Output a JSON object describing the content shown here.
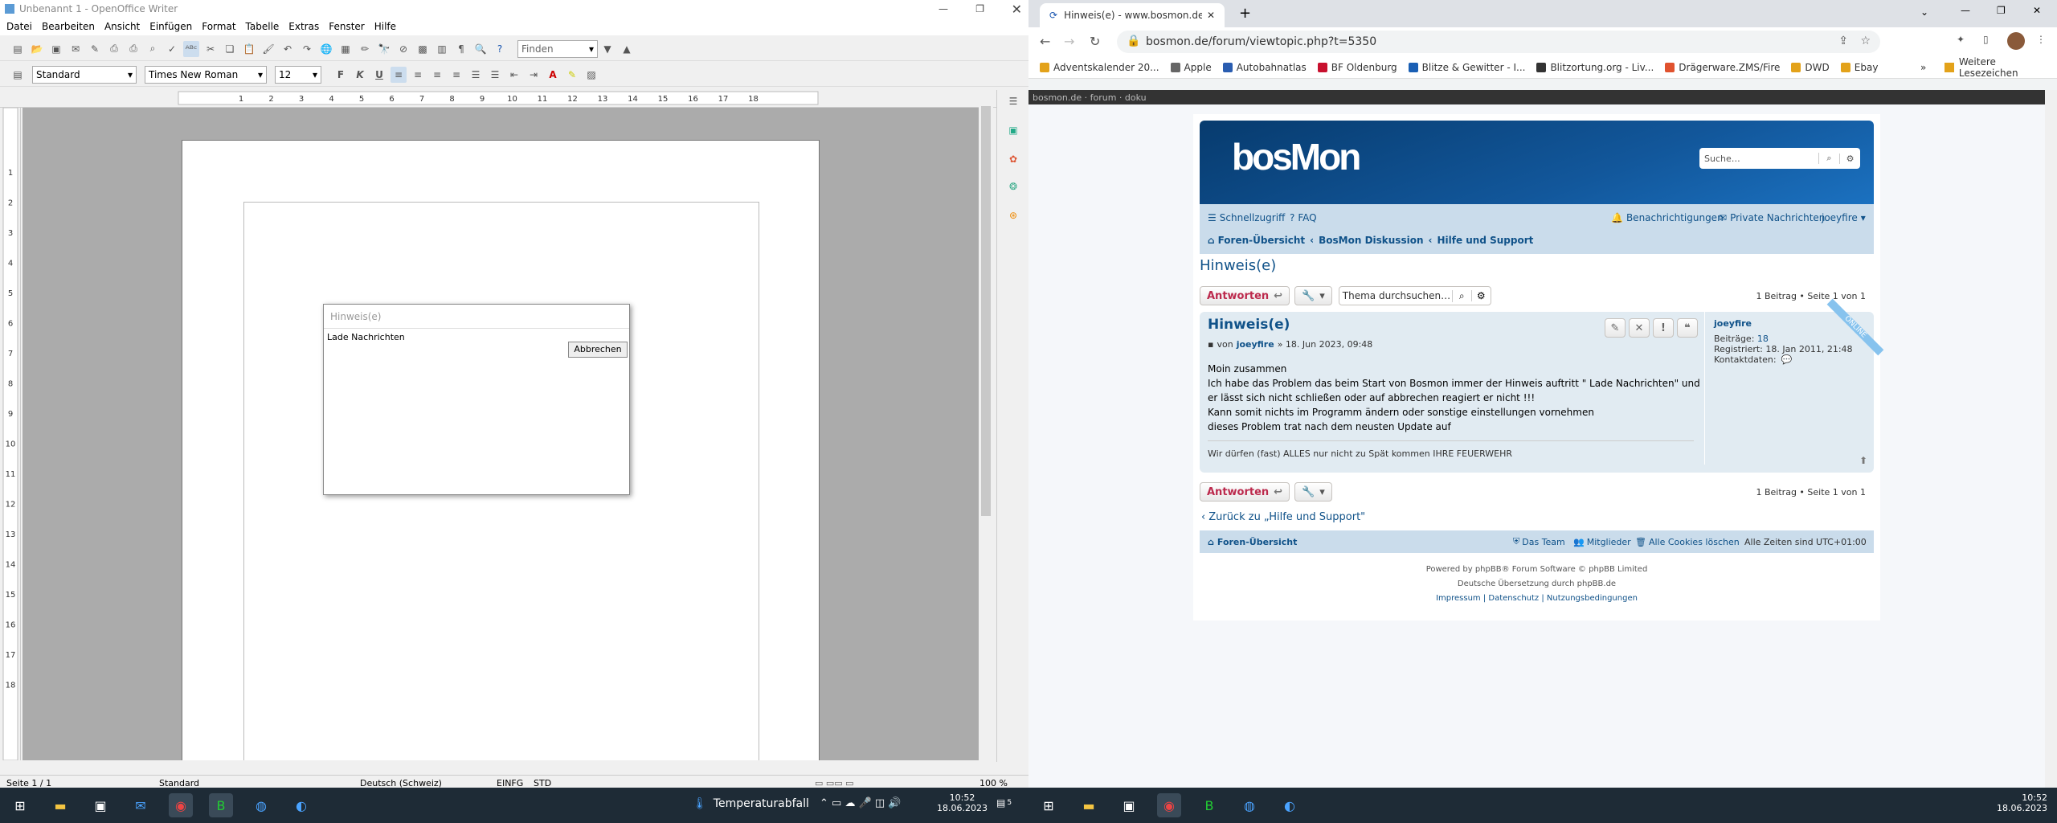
{
  "writer": {
    "title": "Unbenannt 1 - OpenOffice Writer",
    "menu": [
      "Datei",
      "Bearbeiten",
      "Ansicht",
      "Einfügen",
      "Format",
      "Tabelle",
      "Extras",
      "Fenster",
      "Hilfe"
    ],
    "find_placeholder": "Finden",
    "style": "Standard",
    "font": "Times New Roman",
    "size": "12",
    "ruler_marks": [
      "1",
      "2",
      "3",
      "4",
      "5",
      "6",
      "7",
      "8",
      "9",
      "10",
      "11",
      "12",
      "13",
      "14",
      "15",
      "16",
      "17",
      "18"
    ],
    "status": {
      "page": "Seite 1 / 1",
      "style": "Standard",
      "lang": "Deutsch (Schweiz)",
      "insert": "EINFG",
      "sel": "STD",
      "zoom": "100 %"
    },
    "dialog": {
      "title": "Hinweis(e)",
      "message": "Lade Nachrichten",
      "cancel": "Abbrechen"
    }
  },
  "chrome": {
    "tab_title": "Hinweis(e) - www.bosmon.de/fo",
    "url": "bosmon.de/forum/viewtopic.php?t=5350",
    "bookmarks": [
      {
        "label": "Adventskalender 20...",
        "color": "#e3a21a"
      },
      {
        "label": "Apple",
        "color": "#666666"
      },
      {
        "label": "Autobahnatlas",
        "color": "#2a5db0"
      },
      {
        "label": "BF Oldenburg",
        "color": "#c8102e"
      },
      {
        "label": "Blitze & Gewitter - I...",
        "color": "#1a5fb4"
      },
      {
        "label": "Blitzortung.org - Liv...",
        "color": "#333333"
      },
      {
        "label": "Drägerware.ZMS/Fire",
        "color": "#e0522e"
      },
      {
        "label": "DWD",
        "color": "#e3a21a"
      },
      {
        "label": "Ebay",
        "color": "#e3a21a"
      }
    ],
    "more_bookmarks": "Weitere Lesezeichen"
  },
  "forum": {
    "topbar": "bosmon.de · forum · doku",
    "logo": "bosMon",
    "search_placeholder": "Suche…",
    "quicklinks": "Schnellzugriff",
    "faq": "FAQ",
    "notifications": "Benachrichtigungen",
    "pm": "Private Nachrichten",
    "user": "joeyfire",
    "breadcrumb": [
      "Foren-Übersicht",
      "BosMon Diskussion",
      "Hilfe und Support"
    ],
    "topic_title": "Hinweis(e)",
    "reply": "Antworten",
    "topic_search_placeholder": "Thema durchsuchen…",
    "pagination": "1 Beitrag • Seite 1 von 1",
    "post": {
      "title": "Hinweis(e)",
      "meta_by": "von",
      "author": "joeyfire",
      "date": "» 18. Jun 2023, 09:48",
      "lines": [
        "Moin zusammen",
        "Ich habe das Problem das beim Start von Bosmon immer der Hinweis auftritt \" Lade Nachrichten\" und",
        "er lässt sich nicht schließen oder auf abbrechen reagiert er nicht !!!",
        "Kann somit nichts im Programm ändern oder sonstige einstellungen vornehmen",
        "dieses Problem trat nach dem neusten Update auf"
      ],
      "signature": "Wir dürfen (fast) ALLES nur nicht zu Spät kommen IHRE FEUERWEHR",
      "profile_name": "joeyfire",
      "posts_label": "Beiträge:",
      "posts": "18",
      "registered_label": "Registriert:",
      "registered": "18. Jan 2011, 21:48",
      "contact": "Kontaktdaten:",
      "online": "ONLINE"
    },
    "back": "Zurück zu „Hilfe und Support\"",
    "footer_left": "Foren-Übersicht",
    "footer_links": [
      "Das Team",
      "Mitglieder",
      "Alle Cookies löschen"
    ],
    "timezone": "Alle Zeiten sind UTC+01:00",
    "powered1": "Powered by phpBB® Forum Software © phpBB Limited",
    "powered2": "Deutsche Übersetzung durch phpBB.de",
    "powered3": "Impressum | Datenschutz | Nutzungsbedingungen"
  },
  "taskbar": {
    "weather": "Temperaturabfall",
    "time": "10:52",
    "date": "18.06.2023",
    "badge": "5"
  }
}
